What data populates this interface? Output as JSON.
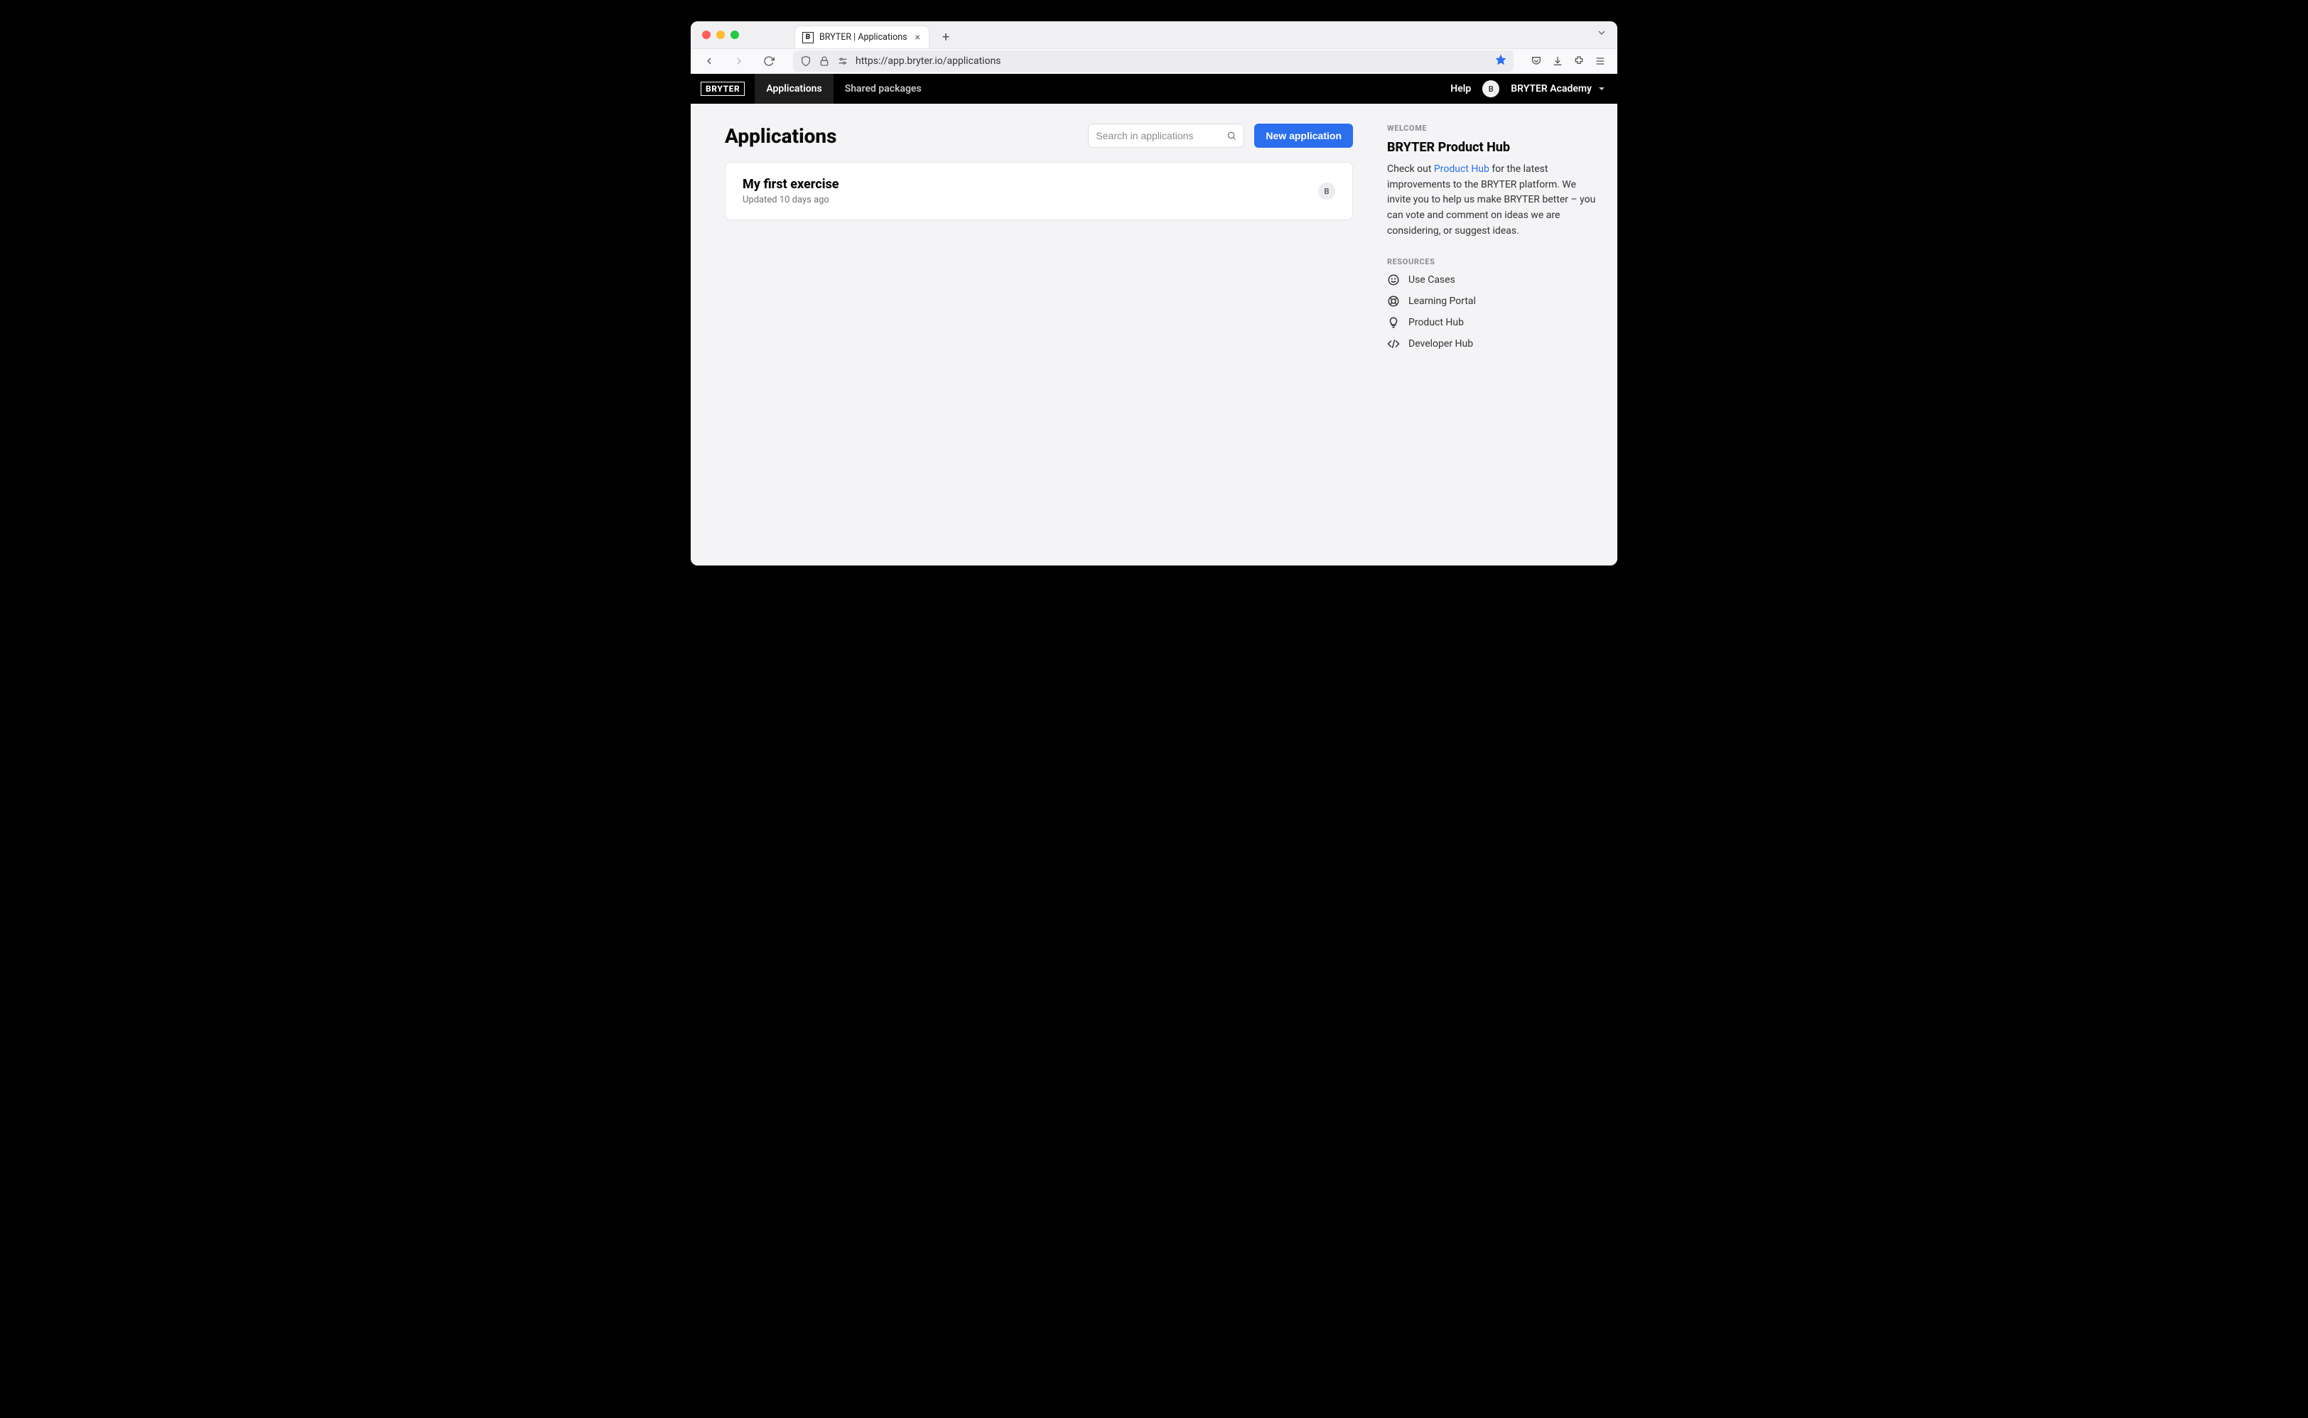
{
  "browser": {
    "tab_title": "BRYTER | Applications",
    "url": "https://app.bryter.io/applications"
  },
  "app_nav": {
    "brand": "BRYTER",
    "tabs": {
      "applications": "Applications",
      "shared_packages": "Shared packages"
    },
    "help_label": "Help",
    "avatar_letter": "B",
    "account_name": "BRYTER Academy"
  },
  "page": {
    "title": "Applications",
    "search_placeholder": "Search in applications",
    "new_button": "New application"
  },
  "applications": [
    {
      "title": "My first exercise",
      "updated": "Updated 10 days ago",
      "owner_initial": "B"
    }
  ],
  "sidebar": {
    "overline": "WELCOME",
    "title": "BRYTER Product Hub",
    "body_prefix": "Check out ",
    "body_link": "Product Hub",
    "body_suffix": " for the latest improvements to the BRYTER platform. We invite you to help us make BRYTER better – you can vote and comment on ideas we are considering, or suggest ideas.",
    "resources_overline": "RESOURCES",
    "resources": {
      "use_cases": "Use Cases",
      "learning_portal": "Learning Portal",
      "product_hub": "Product Hub",
      "developer_hub": "Developer Hub"
    }
  }
}
